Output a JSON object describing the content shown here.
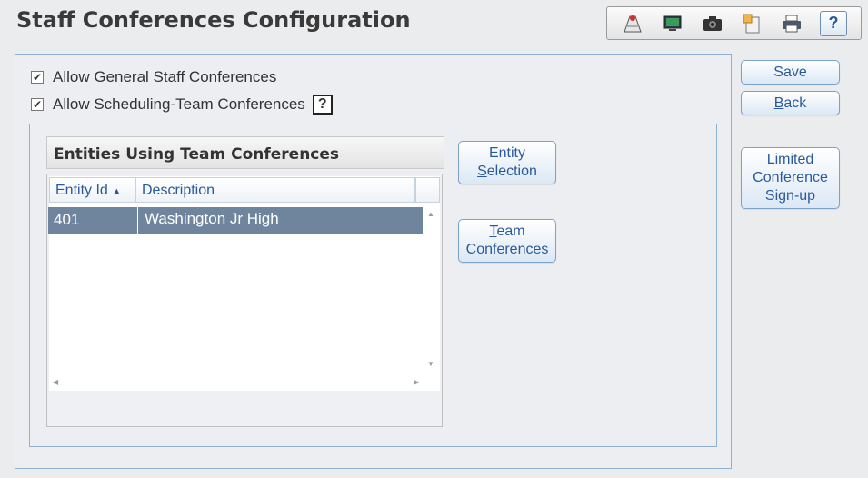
{
  "page": {
    "title": "Staff Conferences Configuration"
  },
  "toolbar": {
    "icons": [
      "report-icon",
      "monitor-icon",
      "camera-icon",
      "clipboard-icon",
      "printer-icon"
    ],
    "help_label": "?"
  },
  "options": {
    "general": {
      "label": "Allow General Staff Conferences",
      "checked": true
    },
    "scheduling_team": {
      "label": "Allow Scheduling-Team Conferences",
      "checked": true
    },
    "help_label": "?"
  },
  "entities": {
    "title": "Entities Using Team Conferences",
    "columns": {
      "id": "Entity Id",
      "description": "Description"
    },
    "rows": [
      {
        "id": "401",
        "description": "Washington Jr High"
      }
    ]
  },
  "buttons": {
    "entity_selection": {
      "line1": "Entity",
      "line2_pre": "",
      "line2_u": "S",
      "line2_post": "election"
    },
    "team_conferences": {
      "line1_u": "T",
      "line1_post": "eam",
      "line2": "Conferences"
    },
    "save": "Save",
    "back_u": "B",
    "back_post": "ack",
    "limited": {
      "line1": "Limited",
      "line2": "Conference",
      "line3": "Sign-up"
    }
  },
  "colors": {
    "accent": "#2a5a9a",
    "selected_row": "#6f859e",
    "border": "#8fb0cf"
  }
}
